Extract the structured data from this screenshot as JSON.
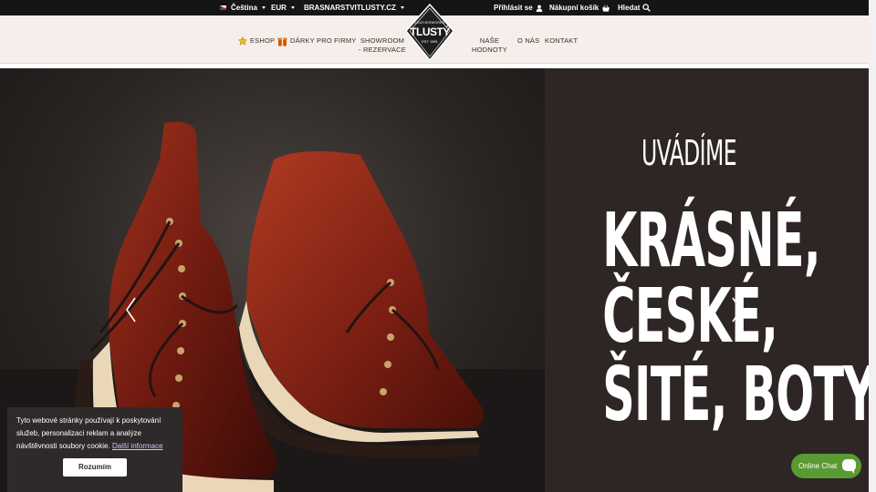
{
  "topbar": {
    "language": "Čeština",
    "currency": "EUR",
    "site_switch": "BRASNARSTVITLUSTY.CZ",
    "login": "Přihlásit se",
    "cart": "Nákupní košík",
    "search": "Hledat"
  },
  "logo": {
    "brand": "TLUSTÝ",
    "top_text": "LEATHERWORKS",
    "est": "EST 1981"
  },
  "nav": {
    "eshop": "ESHOP",
    "gifts": "DÁRKY",
    "business": "PRO FIRMY",
    "showroom_1": "SHOWROOM",
    "showroom_2": "- REZERVACE",
    "values_1": "NAŠE",
    "values_2": "HODNOTY",
    "about": "O NÁS",
    "contact": "KONTAKT"
  },
  "hero": {
    "subtitle": "UVÁDÍME",
    "line1": "KRÁSNÉ,",
    "line2": "ČESKÉ,",
    "line3": "ŠITÉ, BOTY"
  },
  "cookie": {
    "text": "Tyto webové stránky používají k poskytování služeb, personalizaci reklam a analýze návštěvnosti soubory cookie.",
    "link": "Další informace",
    "button": "Rozumím"
  },
  "chat": {
    "label": "Online Chat"
  },
  "colors": {
    "topbar": "#151515",
    "navbar": "#f5eeea",
    "hero_panel": "#2e2624",
    "chat": "#5a9a33"
  }
}
